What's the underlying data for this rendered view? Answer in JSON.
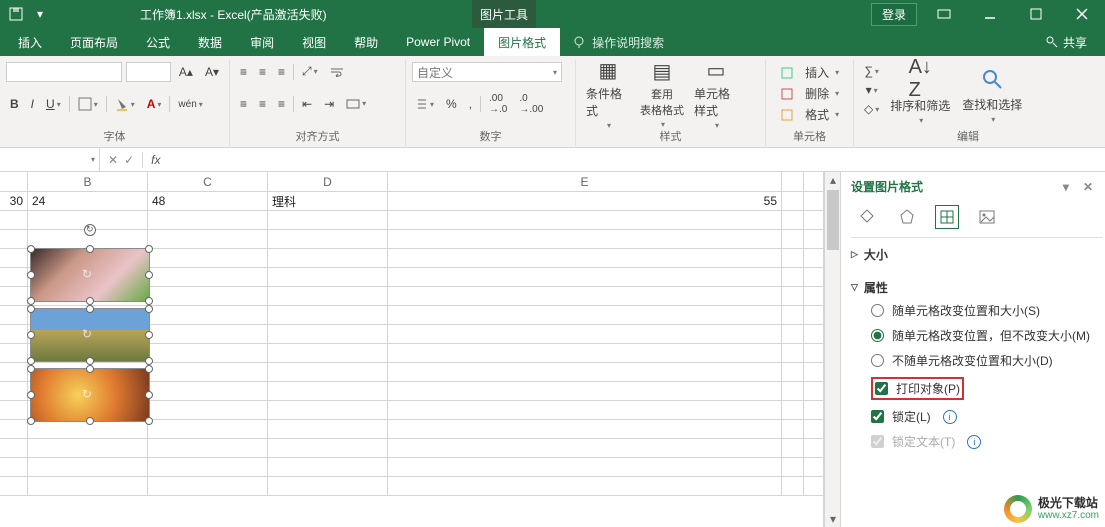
{
  "titlebar": {
    "title": "工作簿1.xlsx  -  Excel(产品激活失败)",
    "context_tool": "图片工具",
    "login": "登录"
  },
  "ribbon_tabs": {
    "items": [
      "插入",
      "页面布局",
      "公式",
      "数据",
      "审阅",
      "视图",
      "帮助",
      "Power Pivot"
    ],
    "context_tab": "图片格式",
    "tell_me": "操作说明搜索",
    "share": "共享"
  },
  "ribbon": {
    "font": {
      "b": "B",
      "i": "I",
      "u": "U",
      "group": "字体"
    },
    "align": {
      "group": "对齐方式"
    },
    "number": {
      "group": "数字",
      "custom": "自定义"
    },
    "styles": {
      "cond": "条件格式",
      "table": "套用\n表格格式",
      "cell": "单元格样式",
      "group": "样式"
    },
    "cells": {
      "insert": "插入",
      "delete": "删除",
      "format": "格式",
      "group": "单元格"
    },
    "editing": {
      "sort": "排序和筛选",
      "find": "查找和选择",
      "group": "编辑"
    }
  },
  "sheet": {
    "cols": [
      "",
      "B",
      "C",
      "D",
      "E",
      ""
    ],
    "row0": [
      "30",
      "24",
      "48",
      "理科",
      "55"
    ]
  },
  "pane": {
    "title": "设置图片格式",
    "sect_size": "大小",
    "sect_props": "属性",
    "opt_move_size": "随单元格改变位置和大小(S)",
    "opt_move_nosize": "随单元格改变位置，但不改变大小(M)",
    "opt_no_move": "不随单元格改变位置和大小(D)",
    "opt_print": "打印对象(P)",
    "opt_lock": "锁定(L)",
    "opt_locktext": "锁定文本(T)"
  },
  "watermark": {
    "cn": "极光下载站",
    "url": "www.xz7.com"
  }
}
